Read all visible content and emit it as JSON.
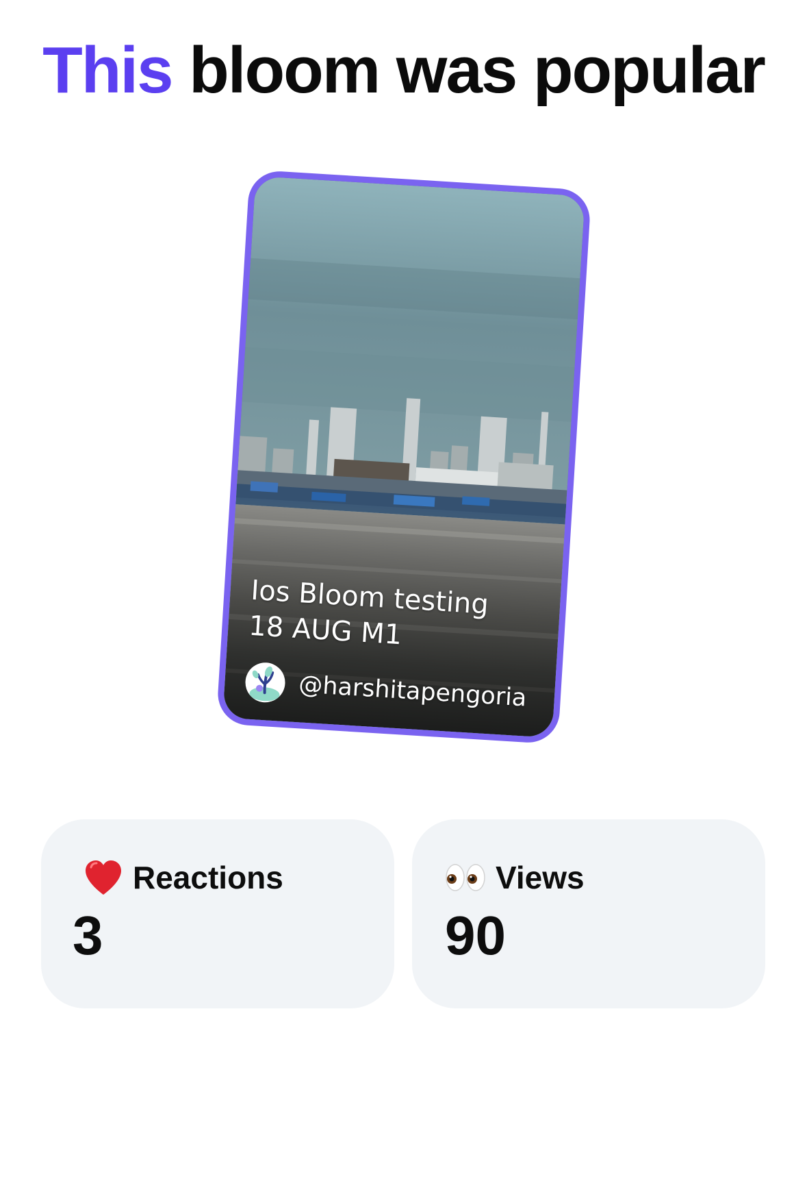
{
  "header": {
    "title_accent": "This",
    "title_rest": "bloom was popular",
    "accent_color": "#5b3ff0"
  },
  "bloom_card": {
    "caption_line1": "Ios Bloom testing",
    "caption_line2": "18 AUG M1",
    "author_handle": "@harshitapengoria",
    "author_avatar_icon": "bloom-plant-icon",
    "border_color": "#7a63f0",
    "image_description_icon": "city-skyline-photo"
  },
  "stats": {
    "reactions": {
      "icon": "heart-icon",
      "label": "Reactions",
      "value": "3"
    },
    "views": {
      "icon": "eyes-icon",
      "label": "Views",
      "value": "90"
    }
  }
}
